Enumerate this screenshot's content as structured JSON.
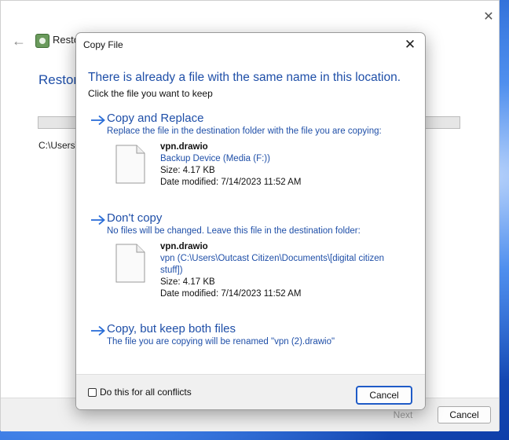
{
  "background_window": {
    "title": "Resto",
    "heading": "Restori",
    "path": "C:\\Users\\",
    "next_label": "Next",
    "cancel_label": "Cancel"
  },
  "dialog": {
    "title": "Copy File",
    "heading": "There is already a file with the same name in this location.",
    "subheading": "Click the file you want to keep",
    "options": [
      {
        "title": "Copy and Replace",
        "description": "Replace the file in the destination folder with the file you are copying:",
        "file": {
          "name": "vpn.drawio",
          "location": "Backup Device (Media (F:))",
          "size": "Size: 4.17 KB",
          "date_modified": "Date modified: 7/14/2023 11:52 AM"
        }
      },
      {
        "title": "Don't copy",
        "description": "No files will be changed. Leave this file in the destination folder:",
        "file": {
          "name": "vpn.drawio",
          "location_line1": "vpn (C:\\Users\\Outcast Citizen\\Documents\\[digital citizen",
          "location_line2": "stuff])",
          "size": "Size: 4.17 KB",
          "date_modified": "Date modified: 7/14/2023 11:52 AM"
        }
      },
      {
        "title": "Copy, but keep both files",
        "description": "The file you are copying will be renamed \"vpn (2).drawio\""
      }
    ],
    "checkbox_label": "Do this for all conflicts",
    "cancel_label": "Cancel"
  },
  "icons": {
    "close": "close-icon",
    "back": "back-arrow-icon",
    "option_arrow": "arrow-right-icon",
    "file": "file-icon"
  },
  "colors": {
    "accent_blue": "#1f4fa8",
    "focus_border": "#1f5bc7"
  }
}
